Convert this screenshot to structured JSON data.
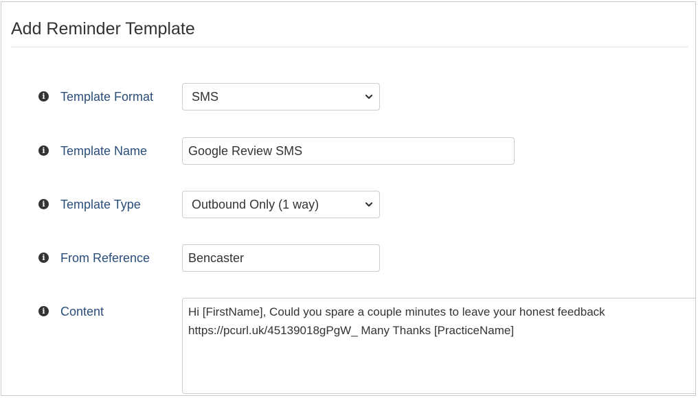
{
  "page": {
    "title": "Add Reminder Template"
  },
  "form": {
    "template_format": {
      "label": "Template Format",
      "value": "SMS"
    },
    "template_name": {
      "label": "Template Name",
      "value": "Google Review SMS"
    },
    "template_type": {
      "label": "Template Type",
      "value": "Outbound Only (1 way)"
    },
    "from_reference": {
      "label": "From Reference",
      "value": "Bencaster"
    },
    "content": {
      "label": "Content",
      "value": "Hi [FirstName], Could you spare a couple minutes to leave your honest feedback https://pcurl.uk/45139018gPgW_ Many Thanks [PracticeName]"
    }
  },
  "icons": {
    "info": "info-circle-icon",
    "dropdown": "chevron-down-icon"
  },
  "colors": {
    "label": "#2a4d7a",
    "text": "#333333",
    "border": "#cccccc"
  }
}
